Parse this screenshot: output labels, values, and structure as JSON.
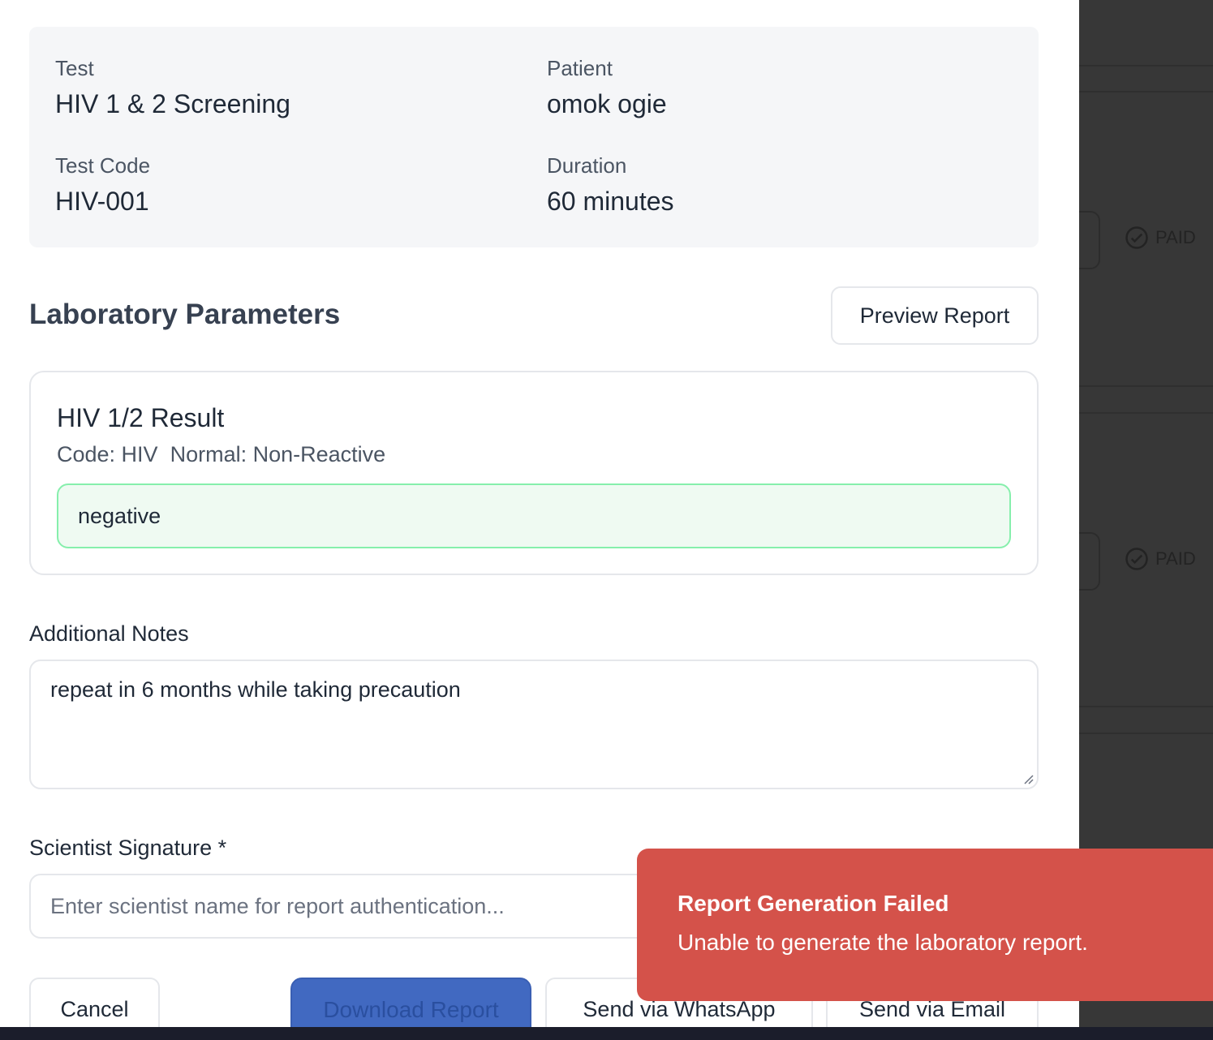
{
  "background": {
    "paid_badges": [
      {
        "label": "PAID"
      },
      {
        "label": "PAID"
      }
    ]
  },
  "modal": {
    "info": {
      "test_label": "Test",
      "test_value": "HIV 1 & 2 Screening",
      "patient_label": "Patient",
      "patient_value": "omok ogie",
      "code_label": "Test Code",
      "code_value": "HIV-001",
      "duration_label": "Duration",
      "duration_value": "60 minutes"
    },
    "section_title": "Laboratory Parameters",
    "preview_button": "Preview Report",
    "parameter": {
      "name": "HIV 1/2 Result",
      "code": "Code: HIV",
      "normal": "Normal: Non-Reactive",
      "value": "negative"
    },
    "notes": {
      "label": "Additional Notes",
      "value": "repeat in 6 months while taking precaution"
    },
    "signature": {
      "label": "Scientist Signature *",
      "placeholder": "Enter scientist name for report authentication..."
    },
    "footer": {
      "cancel": "Cancel",
      "download": "Download Report",
      "whatsapp": "Send via WhatsApp",
      "email": "Send via Email"
    }
  },
  "toast": {
    "title": "Report Generation Failed",
    "message": "Unable to generate the laboratory report."
  },
  "colors": {
    "toast_bg": "#d4524a",
    "primary": "#4169c1",
    "success_border": "#86efac",
    "success_bg": "#effaf2"
  }
}
